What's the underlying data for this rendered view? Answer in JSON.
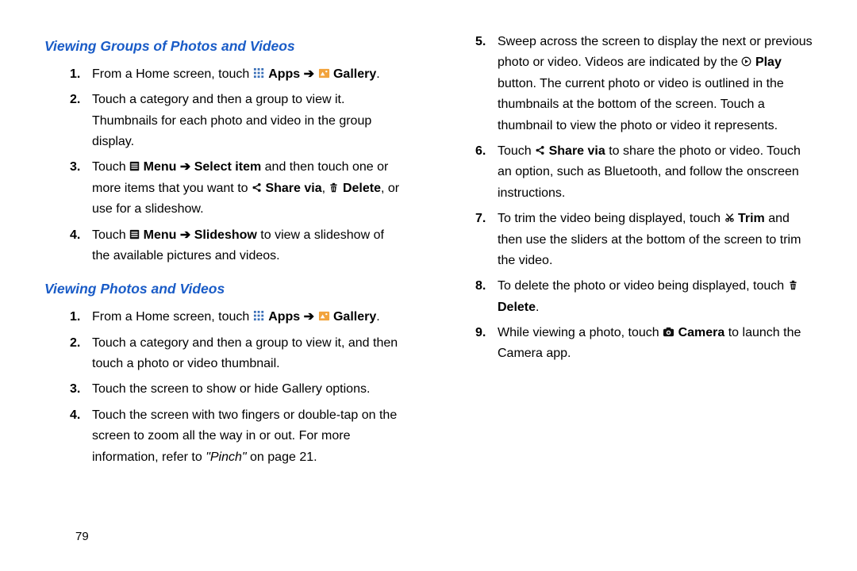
{
  "pageNumber": "79",
  "section1": {
    "heading": "Viewing Groups of Photos and Videos",
    "step1_a": "From a Home screen, touch",
    "apps": "Apps",
    "gallery": "Gallery",
    "step2_a": "Touch a category and then a group to view it.",
    "step2_b": "Thumbnails for each photo and video in the group display.",
    "step3_a": "Touch",
    "menu": "Menu",
    "selectitem": "Select item",
    "step3_b": "and then touch one or more items that you want to",
    "sharevia": "Share via",
    "delete": "Delete",
    "step3_c": ", or use for a slideshow.",
    "step4_a": "Touch",
    "slideshow": "Slideshow",
    "step4_b": "to view a slideshow of the available pictures and videos."
  },
  "section2": {
    "heading": "Viewing Photos and Videos",
    "step1_a": "From a Home screen, touch",
    "apps": "Apps",
    "gallery": "Gallery",
    "step2": "Touch a category and then a group to view it, and then touch a photo or video thumbnail.",
    "step3": "Touch the screen to show or hide Gallery options.",
    "step4_a": "Touch the screen with two fingers or double-tap on the screen to zoom all the way in or out. For more information, refer to",
    "step4_ref": "\"Pinch\"",
    "step4_b": "on page 21."
  },
  "right": {
    "step5_a": "Sweep across the screen to display the next or previous photo or video. Videos are indicated by the",
    "play": "Play",
    "step5_b": "button. The current photo or video is outlined in the thumbnails at the bottom of the screen. Touch a thumbnail to view the photo or video it represents.",
    "step6_a": "Touch",
    "sharevia": "Share via",
    "step6_b": "to share the photo or video. Touch an option, such as Bluetooth, and follow the onscreen instructions.",
    "step7_a": "To trim the video being displayed, touch",
    "trim": "Trim",
    "step7_b": "and then use the sliders at the bottom of the screen to trim the video.",
    "step8_a": "To delete the photo or video being displayed, touch",
    "delete": "Delete",
    "step9_a": "While viewing a photo, touch",
    "camera": "Camera",
    "step9_b": "to launch the Camera app."
  }
}
